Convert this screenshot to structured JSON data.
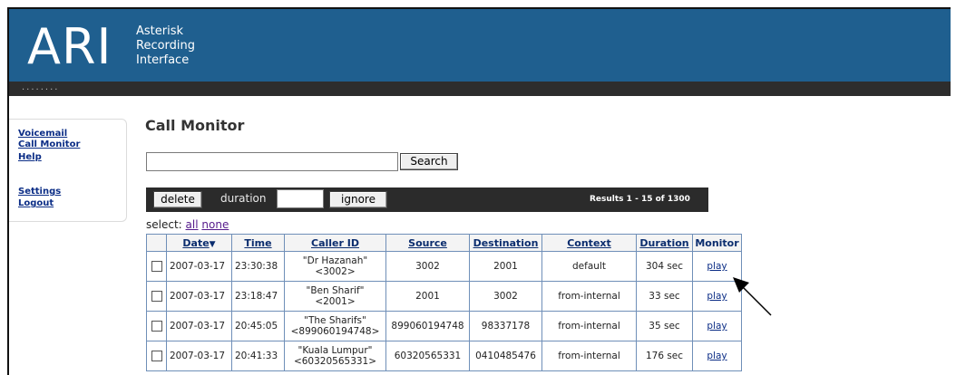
{
  "header": {
    "logo": "ARI",
    "tagline": [
      "Asterisk",
      "Recording",
      "Interface"
    ],
    "dots": "........"
  },
  "sidebar": {
    "items": [
      {
        "label": "Voicemail"
      },
      {
        "label": "Call Monitor"
      },
      {
        "label": "Help"
      },
      {
        "label": "Settings"
      },
      {
        "label": "Logout"
      }
    ]
  },
  "main": {
    "title": "Call Monitor",
    "search": {
      "value": "",
      "button": "Search"
    },
    "toolbar": {
      "delete": "delete",
      "duration_label": "duration",
      "duration_value": "",
      "ignore": "ignore",
      "results": "Results 1 - 15 of 1300"
    },
    "select": {
      "label": "select:",
      "all": "all",
      "none": "none"
    },
    "table": {
      "columns": [
        "",
        "Date",
        "Time",
        "Caller ID",
        "Source",
        "Destination",
        "Context",
        "Duration",
        "Monitor"
      ],
      "sort_glyph": "▼",
      "rows": [
        {
          "date": "2007-03-17",
          "time": "23:30:38",
          "caller_name": "\"Dr Hazanah\"",
          "caller_num": "<3002>",
          "source": "3002",
          "destination": "2001",
          "context": "default",
          "duration": "304 sec",
          "monitor": "play"
        },
        {
          "date": "2007-03-17",
          "time": "23:18:47",
          "caller_name": "\"Ben Sharif\"",
          "caller_num": "<2001>",
          "source": "2001",
          "destination": "3002",
          "context": "from-internal",
          "duration": "33 sec",
          "monitor": "play"
        },
        {
          "date": "2007-03-17",
          "time": "20:45:05",
          "caller_name": "\"The Sharifs\"",
          "caller_num": "<899060194748>",
          "source": "899060194748",
          "destination": "98337178",
          "context": "from-internal",
          "duration": "35 sec",
          "monitor": "play"
        },
        {
          "date": "2007-03-17",
          "time": "20:41:33",
          "caller_name": "\"Kuala Lumpur\"",
          "caller_num": "<60320565331>",
          "source": "60320565331",
          "destination": "0410485476",
          "context": "from-internal",
          "duration": "176 sec",
          "monitor": "play"
        }
      ]
    }
  },
  "colors": {
    "header": "#1f5f8f",
    "dark_bar": "#2d2d2d",
    "toolbar": "#2b2b2b",
    "link": "#0b2d86",
    "table_border": "#6f8fb8"
  }
}
